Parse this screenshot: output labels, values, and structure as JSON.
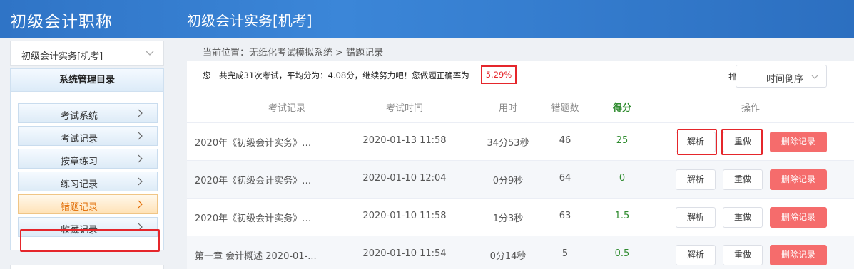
{
  "header": {
    "app_title": "初级会计职称",
    "page_heading": "初级会计实务[机考]"
  },
  "sidebar": {
    "subject": "初级会计实务[机考]",
    "menu_title": "系统管理目录",
    "items": [
      {
        "label": "考试系统"
      },
      {
        "label": "考试记录"
      },
      {
        "label": "按章练习"
      },
      {
        "label": "练习记录"
      },
      {
        "label": "错题记录"
      },
      {
        "label": "收藏记录"
      }
    ]
  },
  "breadcrumb": {
    "text": "当前位置：无纸化考试模拟系统  >  错题记录"
  },
  "summary": {
    "text": "您一共完成31次考试，平均分为：4.08分，继续努力吧！您做题正确率为",
    "rate": "5.29%"
  },
  "sort": {
    "label": "排序：",
    "value": "时间倒序"
  },
  "table": {
    "headers": {
      "record": "考试记录",
      "time": "考试时间",
      "duration": "用时",
      "wrong": "错题数",
      "score": "得分",
      "action": "操作"
    },
    "rows": [
      {
        "record": "2020年《初级会计实务》…",
        "time": "2020-01-13 11:58",
        "duration": "34分53秒",
        "wrong": "46",
        "score": "25",
        "analyze": "解析",
        "redo": "重做",
        "delete": "删除记录"
      },
      {
        "record": "2020年《初级会计实务》…",
        "time": "2020-01-10 12:04",
        "duration": "0分9秒",
        "wrong": "64",
        "score": "0",
        "analyze": "解析",
        "redo": "重做",
        "delete": "删除记录"
      },
      {
        "record": "2020年《初级会计实务》…",
        "time": "2020-01-10 11:58",
        "duration": "1分3秒",
        "wrong": "63",
        "score": "1.5",
        "analyze": "解析",
        "redo": "重做",
        "delete": "删除记录"
      },
      {
        "record": "第一章 会计概述 2020-01-...",
        "time": "2020-01-10 11:54",
        "duration": "0分14秒",
        "wrong": "5",
        "score": "0.5",
        "analyze": "解析",
        "redo": "重做",
        "delete": "删除记录"
      }
    ]
  },
  "colors": {
    "header_blue": "#2f74c6",
    "score_green": "#2e8b2e",
    "danger": "#f56c6c",
    "highlight_red": "#e5262b"
  }
}
